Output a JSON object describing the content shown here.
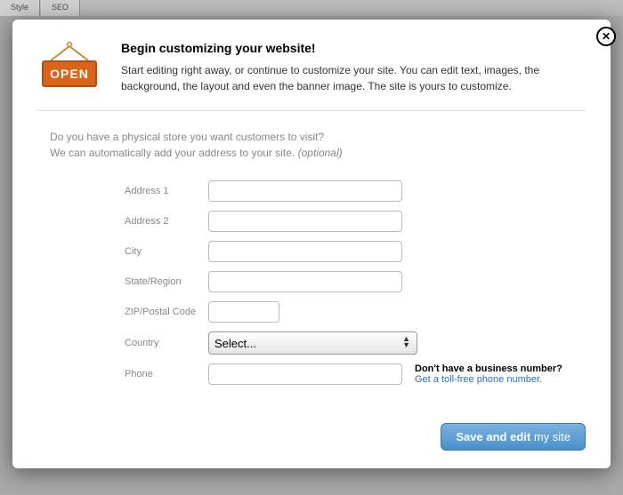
{
  "bgTabs": {
    "style": "Style",
    "seo": "SEO"
  },
  "openSign": "OPEN",
  "header": {
    "title": "Begin customizing your website!",
    "body": "Start editing right away, or continue to customize your site. You can edit text, images, the background, the layout and even the banner image. The site is yours to customize."
  },
  "question": {
    "line1": "Do you have a physical store you want customers to visit?",
    "line2a": "We can automatically add your address to your site. ",
    "line2b": "(optional)"
  },
  "form": {
    "address1": {
      "label": "Address 1",
      "value": ""
    },
    "address2": {
      "label": "Address 2",
      "value": ""
    },
    "city": {
      "label": "City",
      "value": ""
    },
    "state": {
      "label": "State/Region",
      "value": ""
    },
    "zip": {
      "label": "ZIP/Postal Code",
      "value": ""
    },
    "country": {
      "label": "Country",
      "selected": "Select..."
    },
    "phone": {
      "label": "Phone",
      "value": ""
    }
  },
  "phoneSide": {
    "question": "Don't have a business number?",
    "link": "Get a toll-free phone number."
  },
  "saveBtn": {
    "bold": "Save and edit",
    "rest": " my site"
  },
  "closeGlyph": "✕"
}
